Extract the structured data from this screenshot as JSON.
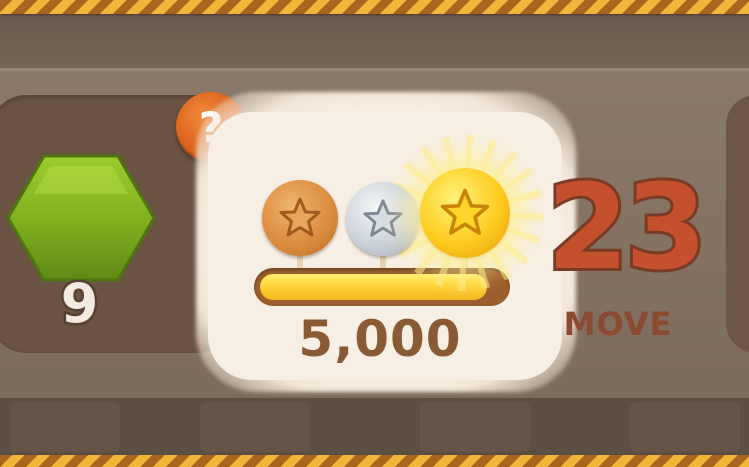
{
  "goal": {
    "item": "green-hexagon-candy",
    "count": "9",
    "help_label": "?"
  },
  "score": {
    "value": "5,000",
    "progress_fraction": 0.93,
    "milestone_fractions": [
      0.17,
      0.5,
      0.83
    ],
    "medals": [
      "bronze-star-medal",
      "silver-star-medal",
      "gold-star-medal"
    ],
    "achieved_medal": "gold-star-medal"
  },
  "moves": {
    "value": "23",
    "label": "MOVE"
  },
  "colors": {
    "rope_light": "#f2b53a",
    "rope_dark": "#a9641e",
    "moves_text": "#c5502e",
    "score_text": "#8a5a35",
    "progress_fill": "#ffd43a",
    "hex_green": "#7fae1f"
  }
}
